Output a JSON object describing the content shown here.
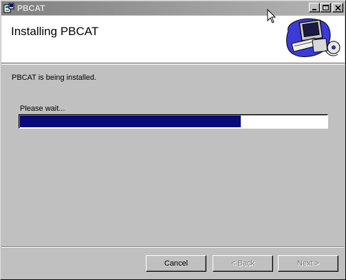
{
  "window": {
    "title": "PBCAT"
  },
  "header": {
    "title": "Installing PBCAT"
  },
  "main": {
    "status_text": "PBCAT is being installed.",
    "wait_label": "Please wait...",
    "progress_fraction": 0.72
  },
  "buttons": {
    "cancel": "Cancel",
    "back": "< Back",
    "next": "Next >"
  },
  "colors": {
    "progress_fill": "#0a0a78",
    "face": "#c0c0c0"
  }
}
